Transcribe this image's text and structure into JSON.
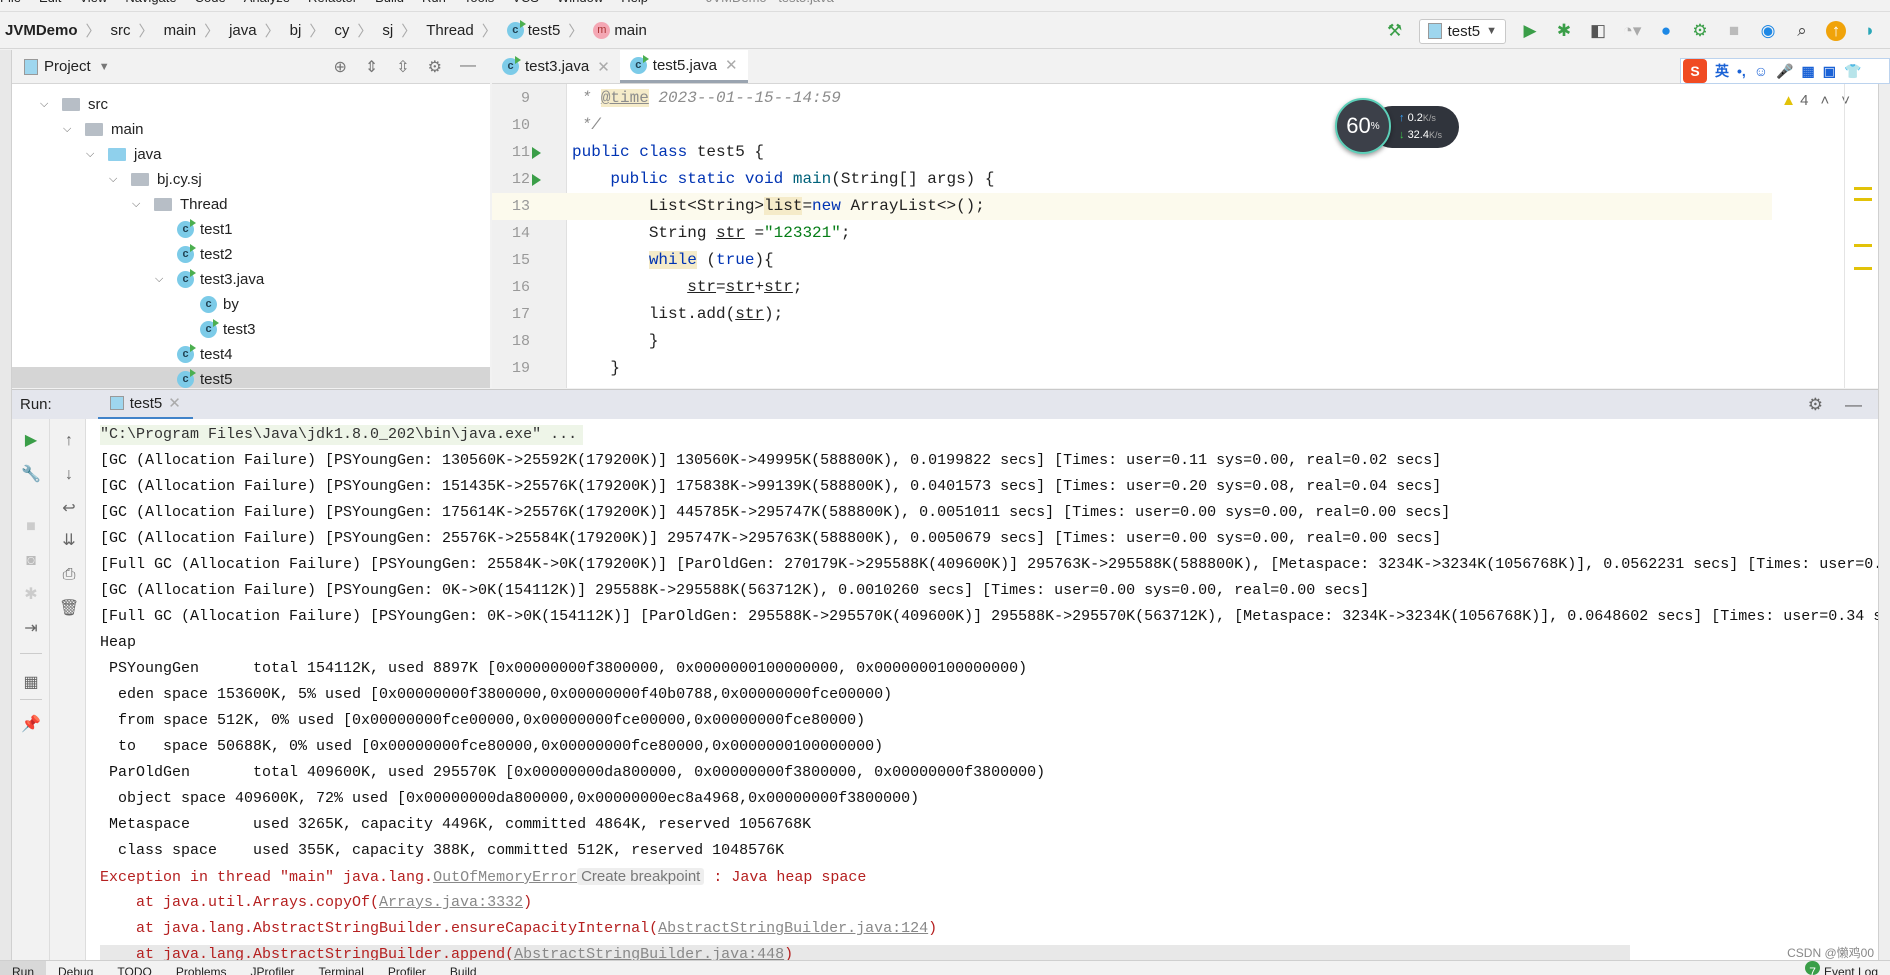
{
  "menu": [
    "File",
    "Edit",
    "View",
    "Navigate",
    "Code",
    "Analyze",
    "Refactor",
    "Build",
    "Run",
    "Tools",
    "VCS",
    "Window",
    "Help"
  ],
  "window_title": "JVMDemo - test5.java",
  "breadcrumb": [
    "JVMDemo",
    "src",
    "main",
    "java",
    "bj",
    "cy",
    "sj",
    "Thread",
    "test5",
    "main"
  ],
  "toolbar": {
    "run_config": "test5"
  },
  "project": {
    "title": "Project",
    "tree": [
      {
        "label": "src",
        "depth": 0,
        "kind": "folder",
        "expanded": true
      },
      {
        "label": "main",
        "depth": 1,
        "kind": "folder",
        "expanded": true
      },
      {
        "label": "java",
        "depth": 2,
        "kind": "src",
        "expanded": true
      },
      {
        "label": "bj.cy.sj",
        "depth": 3,
        "kind": "package",
        "expanded": true
      },
      {
        "label": "Thread",
        "depth": 4,
        "kind": "package",
        "expanded": true
      },
      {
        "label": "test1",
        "depth": 5,
        "kind": "class"
      },
      {
        "label": "test2",
        "depth": 5,
        "kind": "class"
      },
      {
        "label": "test3.java",
        "depth": 5,
        "kind": "class",
        "expanded": true
      },
      {
        "label": "by",
        "depth": 6,
        "kind": "plainclass"
      },
      {
        "label": "test3",
        "depth": 6,
        "kind": "class"
      },
      {
        "label": "test4",
        "depth": 5,
        "kind": "class"
      },
      {
        "label": "test5",
        "depth": 5,
        "kind": "class",
        "selected": true
      }
    ]
  },
  "editor": {
    "tabs": [
      {
        "label": "test3.java"
      },
      {
        "label": "test5.java",
        "active": true
      }
    ],
    "warnings": "4",
    "lines": [
      {
        "n": "9",
        "html": "<span class='cm'> * </span><span class='tag'>@time</span><span class='cm'> 2023--01--15--14:59</span>"
      },
      {
        "n": "10",
        "html": "<span class='cm'> */</span>"
      },
      {
        "n": "11",
        "html": "<span class='kw'>public class</span> test5 {",
        "run": true
      },
      {
        "n": "12",
        "html": "    <span class='kw'>public static void</span> <span style='color:#00627a'>main</span>(String[] args) {",
        "run": true
      },
      {
        "n": "13",
        "html": "        List&lt;String&gt;<span class='hl'>list</span>=<span class='kw'>new</span> ArrayList&lt;&gt;();",
        "current": true
      },
      {
        "n": "14",
        "html": "        String <span class='ul'>str</span> =<span class='str'>\"123321\"</span>;"
      },
      {
        "n": "15",
        "html": "        <span class='kw hl'>while</span> (<span class='kw'>true</span>){"
      },
      {
        "n": "16",
        "html": "            <span class='ul'>str</span>=<span class='ul'>str</span>+<span class='ul'>str</span>;"
      },
      {
        "n": "17",
        "html": "        list.add(<span class='ul'>str</span>);"
      },
      {
        "n": "18",
        "html": "        }"
      },
      {
        "n": "19",
        "html": "    }"
      }
    ]
  },
  "net_widget": {
    "cpu": "60",
    "cpu_unit": "%",
    "up": "0.2",
    "down": "32.4",
    "unit": "K/s"
  },
  "ime": {
    "logo": "S",
    "mode": "英",
    "items": [
      "•,",
      "☺",
      "🎤",
      "▦",
      "▣",
      "👕"
    ]
  },
  "run": {
    "label": "Run:",
    "tab": "test5",
    "console": [
      {
        "type": "cmd",
        "text": "\"C:\\Program Files\\Java\\jdk1.8.0_202\\bin\\java.exe\" ..."
      },
      {
        "text": "[GC (Allocation Failure) [PSYoungGen: 130560K->25592K(179200K)] 130560K->49995K(588800K), 0.0199822 secs] [Times: user=0.11 sys=0.00, real=0.02 secs]"
      },
      {
        "text": "[GC (Allocation Failure) [PSYoungGen: 151435K->25576K(179200K)] 175838K->99139K(588800K), 0.0401573 secs] [Times: user=0.20 sys=0.08, real=0.04 secs]"
      },
      {
        "text": "[GC (Allocation Failure) [PSYoungGen: 175614K->25576K(179200K)] 445785K->295747K(588800K), 0.0051011 secs] [Times: user=0.00 sys=0.00, real=0.00 secs]"
      },
      {
        "text": "[GC (Allocation Failure) [PSYoungGen: 25576K->25584K(179200K)] 295747K->295763K(588800K), 0.0050679 secs] [Times: user=0.00 sys=0.00, real=0.00 secs]"
      },
      {
        "text": "[Full GC (Allocation Failure) [PSYoungGen: 25584K->0K(179200K)] [ParOldGen: 270179K->295588K(409600K)] 295763K->295588K(588800K), [Metaspace: 3234K->3234K(1056768K)], 0.0562231 secs] [Times: user=0."
      },
      {
        "text": "[GC (Allocation Failure) [PSYoungGen: 0K->0K(154112K)] 295588K->295588K(563712K), 0.0010260 secs] [Times: user=0.00 sys=0.00, real=0.00 secs]"
      },
      {
        "text": "[Full GC (Allocation Failure) [PSYoungGen: 0K->0K(154112K)] [ParOldGen: 295588K->295570K(409600K)] 295588K->295570K(563712K), [Metaspace: 3234K->3234K(1056768K)], 0.0648602 secs] [Times: user=0.34 s"
      },
      {
        "text": "Heap"
      },
      {
        "text": " PSYoungGen      total 154112K, used 8897K [0x00000000f3800000, 0x0000000100000000, 0x0000000100000000)"
      },
      {
        "text": "  eden space 153600K, 5% used [0x00000000f3800000,0x00000000f40b0788,0x00000000fce00000)"
      },
      {
        "text": "  from space 512K, 0% used [0x00000000fce00000,0x00000000fce00000,0x00000000fce80000)"
      },
      {
        "text": "  to   space 50688K, 0% used [0x00000000fce80000,0x00000000fce80000,0x0000000100000000)"
      },
      {
        "text": " ParOldGen       total 409600K, used 295570K [0x00000000da800000, 0x00000000f3800000, 0x00000000f3800000)"
      },
      {
        "text": "  object space 409600K, 72% used [0x00000000da800000,0x00000000ec8a4968,0x00000000f3800000)"
      },
      {
        "text": " Metaspace       used 3265K, capacity 4496K, committed 4864K, reserved 1056768K"
      },
      {
        "text": "  class space    used 355K, capacity 388K, committed 512K, reserved 1048576K"
      },
      {
        "type": "exception",
        "prefix": "Exception in thread \"main\" java.lang.",
        "link": "OutOfMemoryError",
        "badge": "Create breakpoint",
        "suffix": " : Java heap space"
      },
      {
        "type": "stack",
        "prefix": "    at java.util.Arrays.copyOf(",
        "link": "Arrays.java:3332",
        "suffix": ")"
      },
      {
        "type": "stack",
        "prefix": "    at java.lang.AbstractStringBuilder.ensureCapacityInternal(",
        "link": "AbstractStringBuilder.java:124",
        "suffix": ")"
      },
      {
        "type": "stack",
        "prefix": "    at java.lang.AbstractStringBuilder.append(",
        "link": "AbstractStringBuilder.java:448",
        "suffix": ")"
      }
    ]
  },
  "statusbar": {
    "items": [
      "Run",
      "Debug",
      "TODO",
      "Problems",
      "JProfiler",
      "Terminal",
      "Profiler",
      "Build"
    ],
    "event_log": "Event Log",
    "event_count": "7"
  },
  "watermark": "CSDN @懒鸡00"
}
